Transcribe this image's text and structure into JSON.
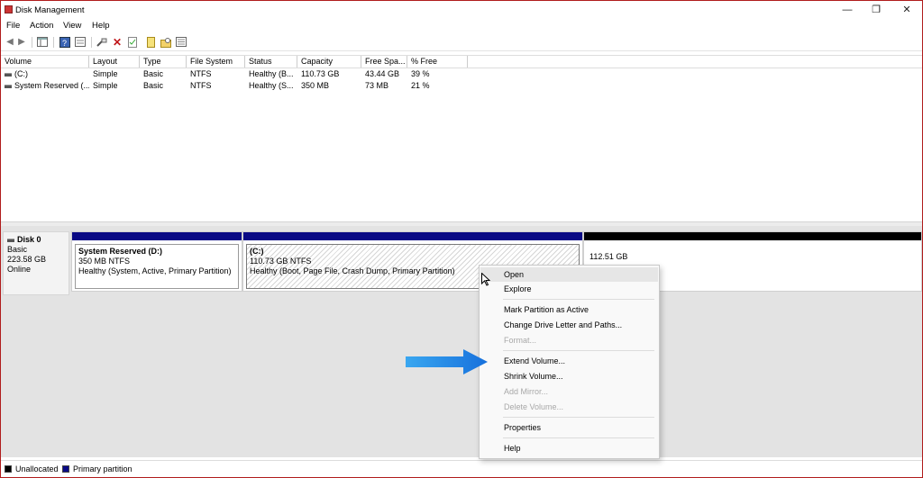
{
  "window": {
    "title": "Disk Management",
    "min": "—",
    "max": "❐",
    "close": "✕"
  },
  "menu": [
    "File",
    "Action",
    "View",
    "Help"
  ],
  "columns": [
    "Volume",
    "Layout",
    "Type",
    "File System",
    "Status",
    "Capacity",
    "Free Spa...",
    "% Free"
  ],
  "volumes": [
    {
      "volume": "(C:)",
      "layout": "Simple",
      "type": "Basic",
      "fs": "NTFS",
      "status": "Healthy (B...",
      "capacity": "110.73 GB",
      "free": "43.44 GB",
      "pct": "39 %"
    },
    {
      "volume": "System Reserved (...",
      "layout": "Simple",
      "type": "Basic",
      "fs": "NTFS",
      "status": "Healthy (S...",
      "capacity": "350 MB",
      "free": "73 MB",
      "pct": "21 %"
    }
  ],
  "disk": {
    "name": "Disk 0",
    "type": "Basic",
    "size": "223.58 GB",
    "state": "Online"
  },
  "partitions": {
    "sysres": {
      "name": "System Reserved  (D:)",
      "size": "350 MB NTFS",
      "status": "Healthy (System, Active, Primary Partition)"
    },
    "c": {
      "name": "(C:)",
      "size": "110.73 GB NTFS",
      "status": "Healthy (Boot, Page File, Crash Dump, Primary Partition)"
    },
    "unalloc": {
      "size": "112.51 GB"
    }
  },
  "legend": {
    "unallocated": "Unallocated",
    "primary": "Primary partition",
    "unallocated_color": "#000000",
    "primary_color": "#0a0a85"
  },
  "context_menu": {
    "open": "Open",
    "explore": "Explore",
    "mark_active": "Mark Partition as Active",
    "change_letter": "Change Drive Letter and Paths...",
    "format": "Format...",
    "extend": "Extend Volume...",
    "shrink": "Shrink Volume...",
    "add_mirror": "Add Mirror...",
    "delete": "Delete Volume...",
    "properties": "Properties",
    "help": "Help"
  },
  "colors": {
    "accent_arrow": "#1a7fe0",
    "window_border": "#b01c1c"
  }
}
